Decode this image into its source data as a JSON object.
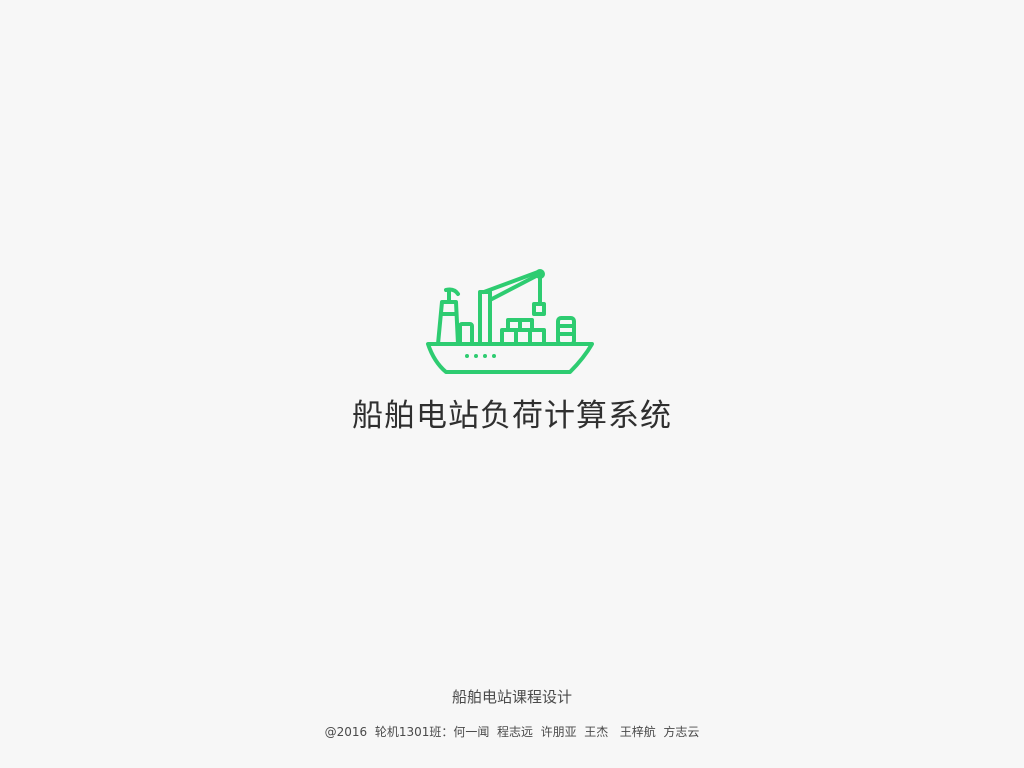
{
  "splash": {
    "logo_icon": "cargo-ship-icon",
    "accent_color": "#2ecc71",
    "title": "船舶电站负荷计算系统",
    "course": "船舶电站课程设计",
    "credits": "@2016  轮机1301班：何一闻  程志远  许朋亚  王杰   王梓航  方志云"
  }
}
